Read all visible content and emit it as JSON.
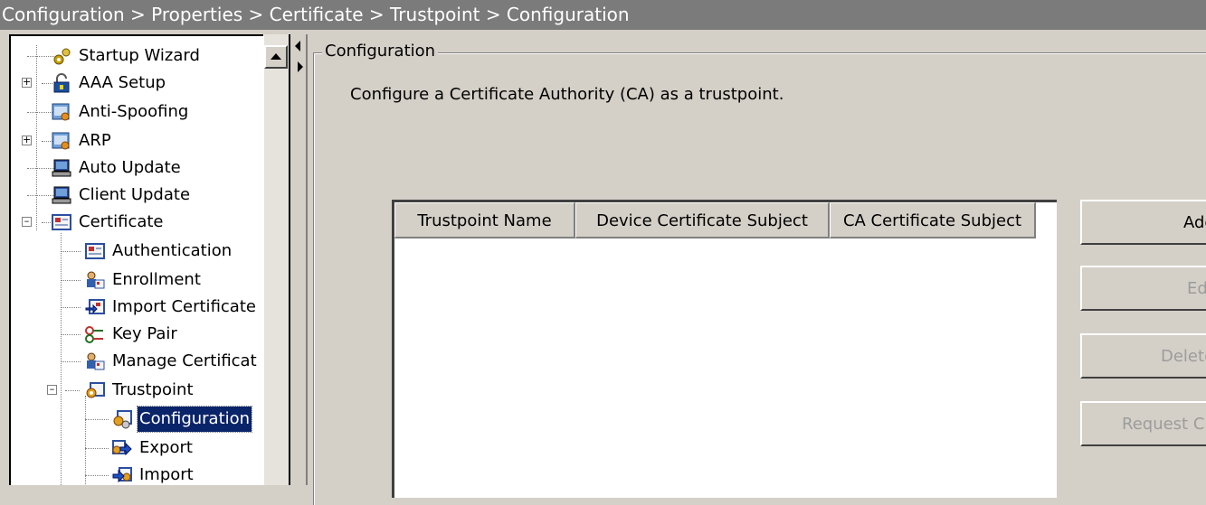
{
  "breadcrumb": "Configuration > Properties > Certificate > Trustpoint > Configuration",
  "tree": {
    "items": [
      {
        "label": "Startup Wizard",
        "icon": "wizard-icon"
      },
      {
        "label": "AAA Setup",
        "icon": "lock-icon"
      },
      {
        "label": "Anti-Spoofing",
        "icon": "settings-box-icon"
      },
      {
        "label": "ARP",
        "icon": "settings-box-icon"
      },
      {
        "label": "Auto Update",
        "icon": "computer-icon"
      },
      {
        "label": "Client Update",
        "icon": "computer-icon"
      },
      {
        "label": "Certificate",
        "icon": "certificate-icon"
      },
      {
        "label": "Authentication",
        "icon": "certificate-icon"
      },
      {
        "label": "Enrollment",
        "icon": "people-icon"
      },
      {
        "label": "Import Certificate",
        "icon": "import-certificate-icon"
      },
      {
        "label": "Key Pair",
        "icon": "key-pair-icon"
      },
      {
        "label": "Manage Certificat",
        "icon": "people-icon"
      },
      {
        "label": "Trustpoint",
        "icon": "trustpoint-icon"
      },
      {
        "label": "Configuration",
        "icon": "trustpoint-config-icon"
      },
      {
        "label": "Export",
        "icon": "export-icon"
      },
      {
        "label": "Import",
        "icon": "import-icon"
      }
    ]
  },
  "panel": {
    "legend": "Configuration",
    "description": "Configure a Certificate Authority (CA) as a trustpoint."
  },
  "table": {
    "columns": [
      "Trustpoint Name",
      "Device Certificate Subject",
      "CA Certificate Subject"
    ],
    "rows": []
  },
  "buttons": {
    "add": "Add",
    "edit": "Edit",
    "delete": "Delete",
    "request": "Request C"
  },
  "colors": {
    "selection": "#0a246a",
    "titlebar": "#7b7b7b",
    "face": "#d4d0c8"
  }
}
